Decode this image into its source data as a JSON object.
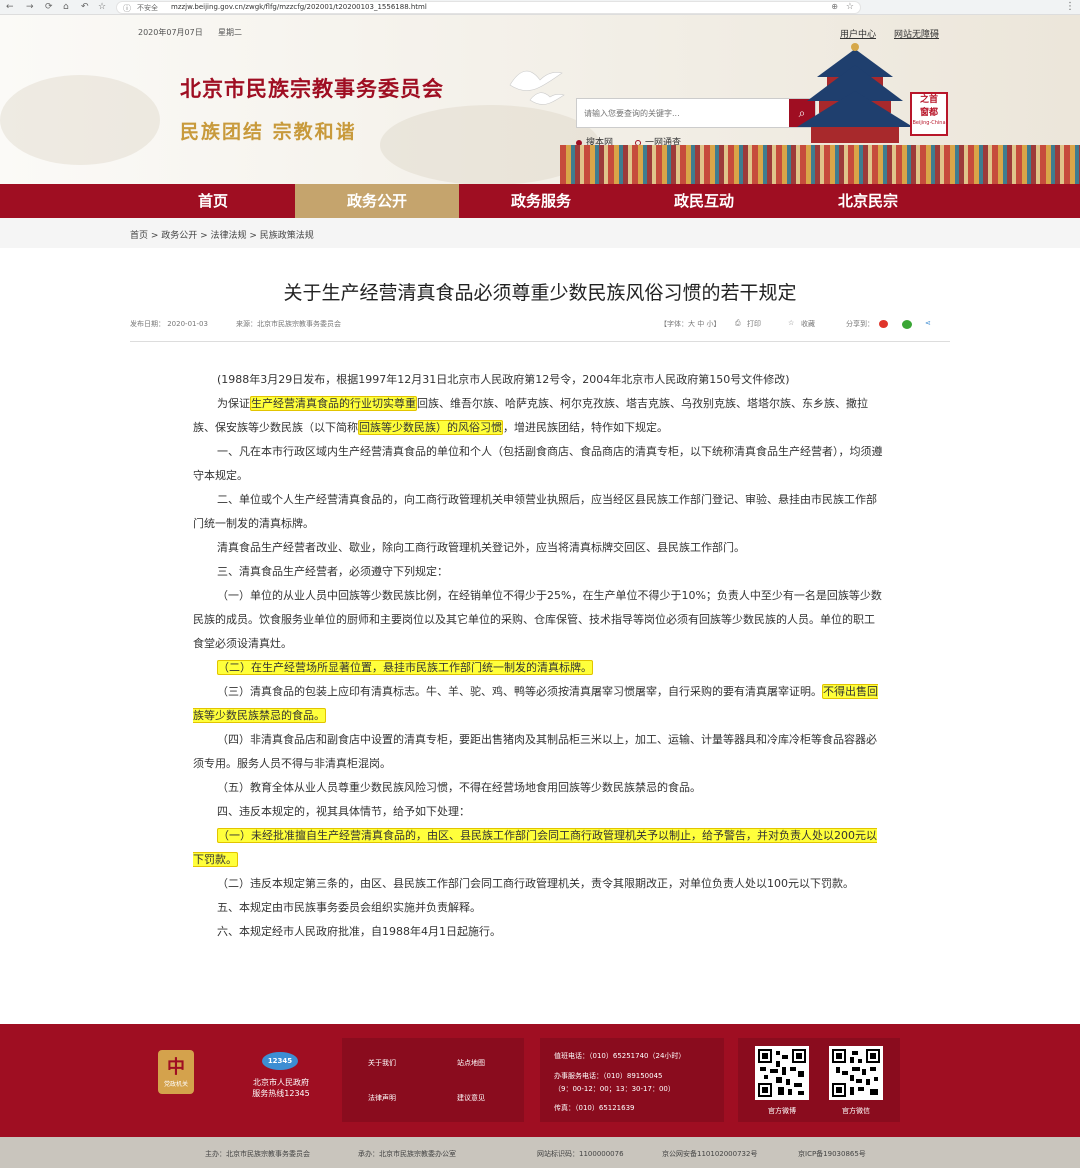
{
  "browser": {
    "insecure_label": "不安全",
    "url": "mzzjw.beijing.gov.cn/zwgk/flfg/mzzcfg/202001/t20200103_1556188.html"
  },
  "header": {
    "date": "2020年07月07日",
    "weekday": "星期二",
    "user_center": "用户中心",
    "accessibility": "网站无障碍",
    "site_title": "北京市民族宗教事务委员会",
    "slogan": "民族团结 宗教和谐",
    "search_placeholder": "请输入您要查询的关键字...",
    "radio_site": "搜本网",
    "radio_all": "一网通查",
    "capital_logo_chars": [
      "首",
      "之",
      "都",
      "窗"
    ],
    "capital_logo_en": "Beijing-China"
  },
  "nav": {
    "items": [
      {
        "label": "首页"
      },
      {
        "label": "政务公开"
      },
      {
        "label": "政务服务"
      },
      {
        "label": "政民互动"
      },
      {
        "label": "北京民宗"
      }
    ]
  },
  "breadcrumb": "首页 > 政务公开 > 法律法规 > 民族政策法规",
  "article": {
    "title": "关于生产经营清真食品必须尊重少数民族风俗习惯的若干规定",
    "meta": {
      "date": "发布日期：  2020-01-03",
      "source": "来源：北京市民族宗教事务委员会",
      "font_size": "【字体：大  中  小】",
      "print": "打印",
      "favorite": "收藏",
      "share": "分享到："
    }
  },
  "content": {
    "p1": "(1988年3月29日发布，根据1997年12月31日北京市人民政府第12号令，2004年北京市人民政府第150号文件修改)",
    "p2_a": "为保证",
    "p2_hl1": "生产经营清真食品的行业切实尊重",
    "p2_b": "回族、维吾尔族、哈萨克族、柯尔克孜族、塔吉克族、乌孜别克族、塔塔尔族、东乡族、撒拉族、保安族等少数民族（以下简称",
    "p2_hl2": "回族等少数民族）的风俗习惯",
    "p2_c": "，增进民族团结，特作如下规定。",
    "p3": "一、凡在本市行政区域内生产经营清真食品的单位和个人（包括副食商店、食品商店的清真专柜，以下统称清真食品生产经营者），均须遵守本规定。",
    "p4": "二、单位或个人生产经营清真食品的，向工商行政管理机关申领营业执照后，应当经区县民族工作部门登记、审验、悬挂由市民族工作部门统一制发的清真标牌。",
    "p5": "清真食品生产经营者改业、歇业，除向工商行政管理机关登记外，应当将清真标牌交回区、县民族工作部门。",
    "p6": "三、清真食品生产经营者，必须遵守下列规定：",
    "p7": "（一）单位的从业人员中回族等少数民族比例，在经销单位不得少于25%，在生产单位不得少于10%；负责人中至少有一名是回族等少数民族的成员。饮食服务业单位的厨师和主要岗位以及其它单位的采购、仓库保管、技术指导等岗位必须有回族等少数民族的人员。单位的职工食堂必须设清真灶。",
    "p8_hl": "（二）在生产经营场所显著位置，悬挂市民族工作部门统一制发的清真标牌。",
    "p9_a": "（三）清真食品的包装上应印有清真标志。牛、羊、驼、鸡、鸭等必须按清真屠宰习惯屠宰，自行采购的要有清真屠宰证明。",
    "p9_hl": "不得出售回族等少数民族禁忌的食品。",
    "p10": "（四）非清真食品店和副食店中设置的清真专柜，要距出售猪肉及其制品柜三米以上，加工、运输、计量等器具和冷库冷柜等食品容器必须专用。服务人员不得与非清真柜混岗。",
    "p11": "（五）教育全体从业人员尊重少数民族风险习惯，不得在经营场地食用回族等少数民族禁忌的食品。",
    "p12": "四、违反本规定的，视其具体情节，给予如下处理：",
    "p13_hl": "（一）未经批准擅自生产经营清真食品的，由区、县民族工作部门会同工商行政管理机关予以制止，给予警告，并对负责人处以200元以下罚款。",
    "p14": "（二）违反本规定第三条的，由区、县民族工作部门会同工商行政管理机关，责令其限期改正，对单位负责人处以100元以下罚款。",
    "p15": "五、本规定由市民族事务委员会组织实施并负责解释。",
    "p16": "六、本规定经市人民政府批准，自1988年4月1日起施行。"
  },
  "footer": {
    "emblem_label": "党政机关",
    "hotline_badge": "12345",
    "hotline_line1": "北京市人民政府",
    "hotline_line2": "服务热线12345",
    "links": {
      "about": "关于我们",
      "sitemap": "站点地图",
      "legal": "法律声明",
      "feedback": "建议意见"
    },
    "contact": {
      "duty_phone": "值班电话：（010）65251740（24小时）",
      "service_phone": "办事服务电话：（010）89150045",
      "service_hours": "（9：00-12：00；13：30-17：00）",
      "fax": "传真：（010）65121639"
    },
    "qr1_label": "官方微博",
    "qr2_label": "官方微信"
  },
  "bottom_bar": {
    "host": "主办：北京市民族宗教事务委员会",
    "organizer": "承办：北京市民族宗教委办公室",
    "site_id": "网站标识码：1100000076",
    "police_record": "京公网安备110102000732号",
    "icp": "京ICP备19030865号"
  }
}
